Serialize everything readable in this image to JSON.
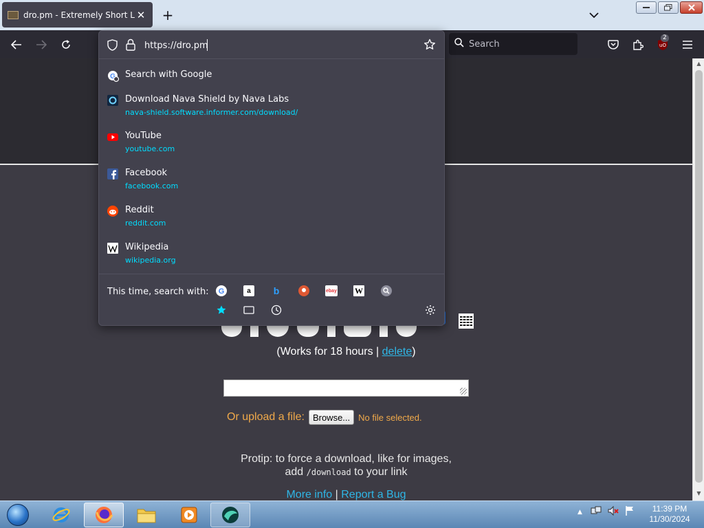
{
  "browser": {
    "tab_title": "dro.pm - Extremely Short Links",
    "url_value": "https://dro.pm",
    "search_placeholder": "Search",
    "extension_badge": "2"
  },
  "urlbar": {
    "search_with": "Search with Google",
    "suggestions": [
      {
        "title": "Download Nava Shield by Nava Labs",
        "url": "nava-shield.software.informer.com/download/"
      },
      {
        "title": "YouTube",
        "url": "youtube.com"
      },
      {
        "title": "Facebook",
        "url": "facebook.com"
      },
      {
        "title": "Reddit",
        "url": "reddit.com"
      },
      {
        "title": "Wikipedia",
        "url": "wikipedia.org"
      }
    ],
    "one_off_label": "This time, search with:",
    "engine_glyphs": {
      "amazon": "a",
      "bing": "b",
      "ebay": "ebay",
      "wikipedia": "W"
    },
    "engines": [
      "google-icon",
      "amazon-icon",
      "bing-icon",
      "duckduckgo-icon",
      "ebay-icon",
      "wikipedia-icon",
      "search-icon"
    ],
    "modes": [
      "bookmarks-star-icon",
      "tabs-icon",
      "history-clock-icon"
    ]
  },
  "page": {
    "works_prefix": "(Works for 18 hours | ",
    "delete_link": "delete",
    "works_suffix": ")",
    "upload_label": "Or upload a file:",
    "browse_button": "Browse...",
    "no_file": "No file selected.",
    "protip_line1": "Protip: to force a download, like for images,",
    "protip_add": "add",
    "protip_code": "/download",
    "protip_end": "to your link",
    "more_info": "More info",
    "separator": "|",
    "report_bug": "Report a Bug"
  },
  "taskbar": {
    "time": "11:39 PM",
    "date": "11/30/2024"
  },
  "colors": {
    "accent": "#00ddff",
    "link": "#2fb6e6",
    "upload_orange": "#f0a94a"
  }
}
